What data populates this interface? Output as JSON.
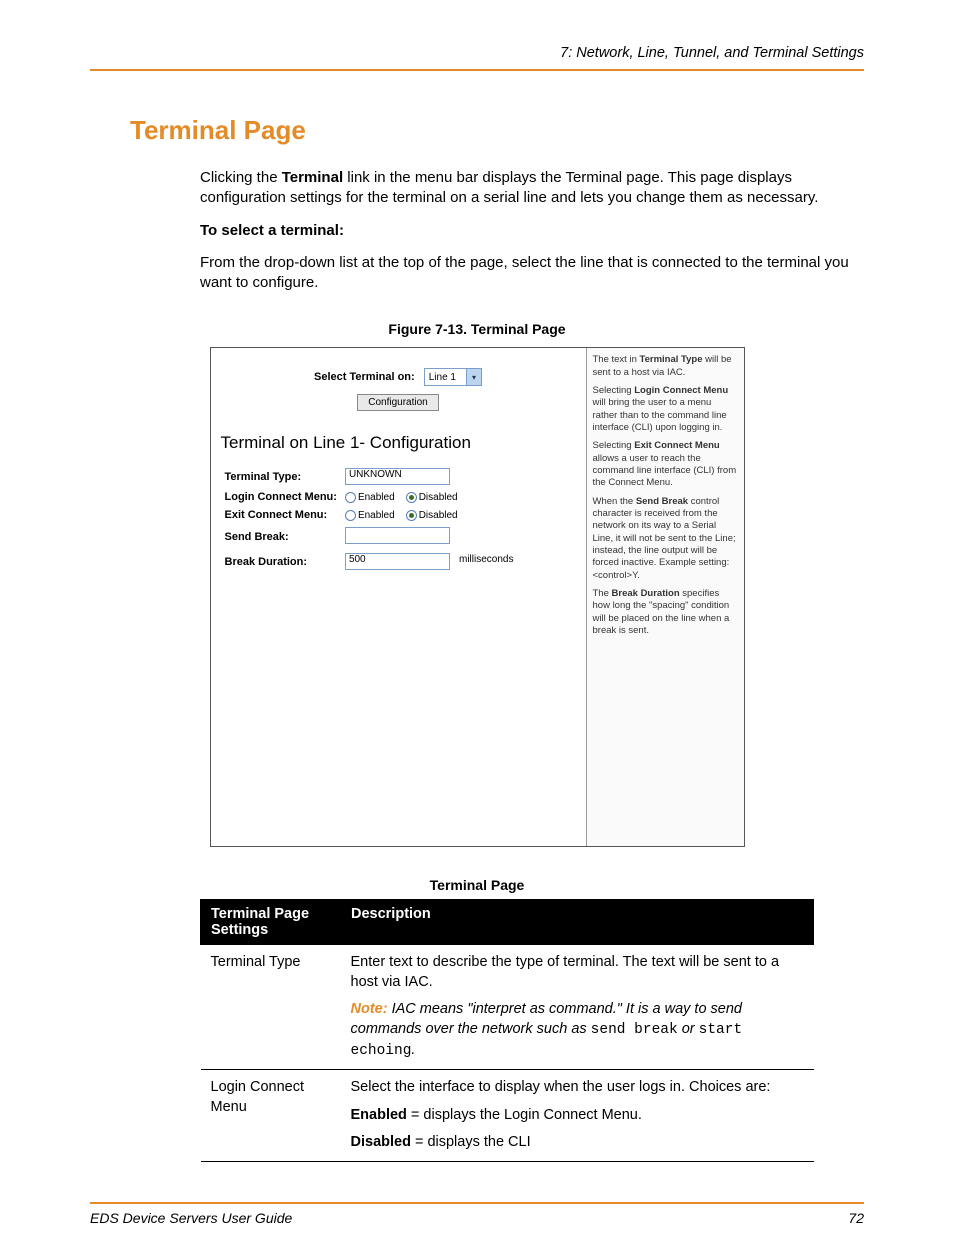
{
  "header": {
    "running_head": "7: Network, Line, Tunnel, and Terminal Settings"
  },
  "title": "Terminal Page",
  "paras": {
    "intro": "Clicking the Terminal link in the menu bar displays the Terminal page. This page displays configuration settings for the terminal on a serial line and lets you change them as necessary.",
    "intro_bold_word": "Terminal",
    "select_heading": "To select a terminal:",
    "select_body": "From the drop-down list at the top of the page, select the line that is connected to the terminal you want to configure."
  },
  "figure": {
    "caption": "Figure 7-13. Terminal Page",
    "select_label": "Select Terminal on:",
    "select_value": "Line 1",
    "config_button": "Configuration",
    "section_title": "Terminal on Line 1- Configuration",
    "rows": {
      "terminal_type_label": "Terminal Type:",
      "terminal_type_value": "UNKNOWN",
      "login_label": "Login Connect Menu:",
      "exit_label": "Exit Connect Menu:",
      "enabled": "Enabled",
      "disabled": "Disabled",
      "send_break_label": "Send Break:",
      "send_break_value": "",
      "break_duration_label": "Break Duration:",
      "break_duration_value": "500",
      "break_duration_units": "milliseconds"
    },
    "help": {
      "p1a": "The text in ",
      "p1b": "Terminal Type",
      "p1c": " will be sent to a host via IAC.",
      "p2a": "Selecting ",
      "p2b": "Login Connect Menu",
      "p2c": " will bring the user to a menu rather than to the command line interface (CLI) upon logging in.",
      "p3a": "Selecting ",
      "p3b": "Exit Connect Menu",
      "p3c": " allows a user to reach the command line interface (CLI) from the Connect Menu.",
      "p4a": "When the ",
      "p4b": "Send Break",
      "p4c": " control character is received from the network on its way to a Serial Line, it will not be sent to the Line; instead, the line output will be forced inactive. Example setting: <control>Y.",
      "p5a": "The ",
      "p5b": "Break Duration",
      "p5c": " specifies how long the \"spacing\" condition will be placed on the line when a break is sent."
    }
  },
  "table": {
    "caption": "Terminal Page",
    "col1": "Terminal Page Settings",
    "col2": "Description",
    "rows": [
      {
        "name": "Terminal Type",
        "desc1": "Enter text to describe the type of terminal. The text will be sent to a host via IAC.",
        "note_label": "Note:",
        "note_body_pre": " IAC means \"interpret as command.\" It is a way to send commands over the network such as ",
        "note_code1": "send break",
        "note_mid": " or ",
        "note_code2": "start echoing",
        "note_post": "."
      },
      {
        "name": "Login Connect Menu",
        "desc1": "Select the interface to display when the user logs in. Choices are:",
        "bullet1_b": "Enabled",
        "bullet1_t": " = displays the Login Connect Menu.",
        "bullet2_b": "Disabled",
        "bullet2_t": " = displays the CLI"
      }
    ]
  },
  "footer": {
    "left": "EDS Device Servers User Guide",
    "right": "72"
  }
}
